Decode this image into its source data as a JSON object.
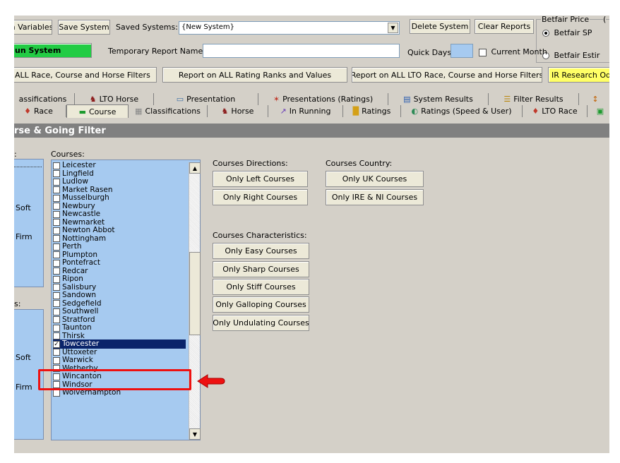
{
  "toolbar": {
    "variables_label": "n Variables",
    "save_system_label": "Save System",
    "saved_systems_label": "Saved Systems:",
    "saved_systems_value": "{New System}",
    "delete_system_label": "Delete System",
    "clear_reports_label": "Clear Reports",
    "run_system_label": "un System",
    "temp_report_label": "Temporary Report Name:",
    "temp_report_value": "",
    "quick_days_label": "Quick Days",
    "current_month_label": "Current Month",
    "report_all_filters": "ALL Race, Course and Horse Filters",
    "report_rating_ranks": "Report on ALL Rating Ranks and Values",
    "report_lto": "Report on ALL LTO Race, Course and Horse Filters",
    "ir_research": "IR Research Od"
  },
  "betfair": {
    "group_label": "Betfair Price",
    "group_label_trail": "(",
    "option_sp": "Betfair SP",
    "option_est": "Betfair Estir"
  },
  "tabs_top": [
    {
      "label": "assifications",
      "icon": ""
    },
    {
      "label": "LTO Horse",
      "icon": "♞"
    },
    {
      "label": "Presentation",
      "icon": "▭"
    },
    {
      "label": "Presentations (Ratings)",
      "icon": "✶"
    },
    {
      "label": "System Results",
      "icon": "▤"
    },
    {
      "label": "Filter Results",
      "icon": "☰"
    },
    {
      "label": "",
      "icon": "↕"
    }
  ],
  "tabs_bottom": [
    {
      "label": "Race",
      "icon": "♦"
    },
    {
      "label": "Course",
      "icon": "▬"
    },
    {
      "label": "Classifications",
      "icon": "▦"
    },
    {
      "label": "Horse",
      "icon": "♞"
    },
    {
      "label": "In Running",
      "icon": "↗"
    },
    {
      "label": "Ratings",
      "icon": "█"
    },
    {
      "label": "Ratings (Speed & User)",
      "icon": "◐"
    },
    {
      "label": "LTO Race",
      "icon": "♦"
    },
    {
      "label": "",
      "icon": "▣"
    }
  ],
  "section_title": "rse & Going Filter",
  "left_panel": {
    "top_label": ":",
    "soft_1": "Soft",
    "firm_1": "Firm",
    "mid_label": "s:",
    "soft_2": "Soft",
    "firm_2": "Firm"
  },
  "courses": {
    "label": "Courses:",
    "items": [
      {
        "name": "Leicester",
        "checked": false
      },
      {
        "name": "Lingfield",
        "checked": false
      },
      {
        "name": "Ludlow",
        "checked": false
      },
      {
        "name": "Market Rasen",
        "checked": false
      },
      {
        "name": "Musselburgh",
        "checked": false
      },
      {
        "name": "Newbury",
        "checked": false
      },
      {
        "name": "Newcastle",
        "checked": false
      },
      {
        "name": "Newmarket",
        "checked": false
      },
      {
        "name": "Newton Abbot",
        "checked": false
      },
      {
        "name": "Nottingham",
        "checked": false
      },
      {
        "name": "Perth",
        "checked": false
      },
      {
        "name": "Plumpton",
        "checked": false
      },
      {
        "name": "Pontefract",
        "checked": false
      },
      {
        "name": "Redcar",
        "checked": false
      },
      {
        "name": "Ripon",
        "checked": false
      },
      {
        "name": "Salisbury",
        "checked": false
      },
      {
        "name": "Sandown",
        "checked": false
      },
      {
        "name": "Sedgefield",
        "checked": false
      },
      {
        "name": "Southwell",
        "checked": false
      },
      {
        "name": "Stratford",
        "checked": false
      },
      {
        "name": "Taunton",
        "checked": false
      },
      {
        "name": "Thirsk",
        "checked": false
      },
      {
        "name": "Towcester",
        "checked": true
      },
      {
        "name": "Uttoxeter",
        "checked": false
      },
      {
        "name": "Warwick",
        "checked": false
      },
      {
        "name": "Wetherby",
        "checked": false
      },
      {
        "name": "Wincanton",
        "checked": false
      },
      {
        "name": "Windsor",
        "checked": false
      },
      {
        "name": "Wolverhampton",
        "checked": false
      }
    ]
  },
  "directions": {
    "label": "Courses Directions:",
    "left": "Only Left Courses",
    "right": "Only Right Courses"
  },
  "country": {
    "label": "Courses Country:",
    "uk": "Only UK Courses",
    "ire": "Only IRE & NI Courses"
  },
  "characteristics": {
    "label": "Courses Characteristics:",
    "easy": "Only Easy Courses",
    "sharp": "Only Sharp Courses",
    "stiff": "Only Stiff Courses",
    "galloping": "Only Galloping Courses",
    "undulating": "Only Undulating Courses"
  },
  "colors": {
    "run_button": "#22cc44",
    "ir_research": "#ffff66",
    "selection": "#0a246a",
    "panel": "#a6caf0",
    "highlight": "#ee1111"
  }
}
